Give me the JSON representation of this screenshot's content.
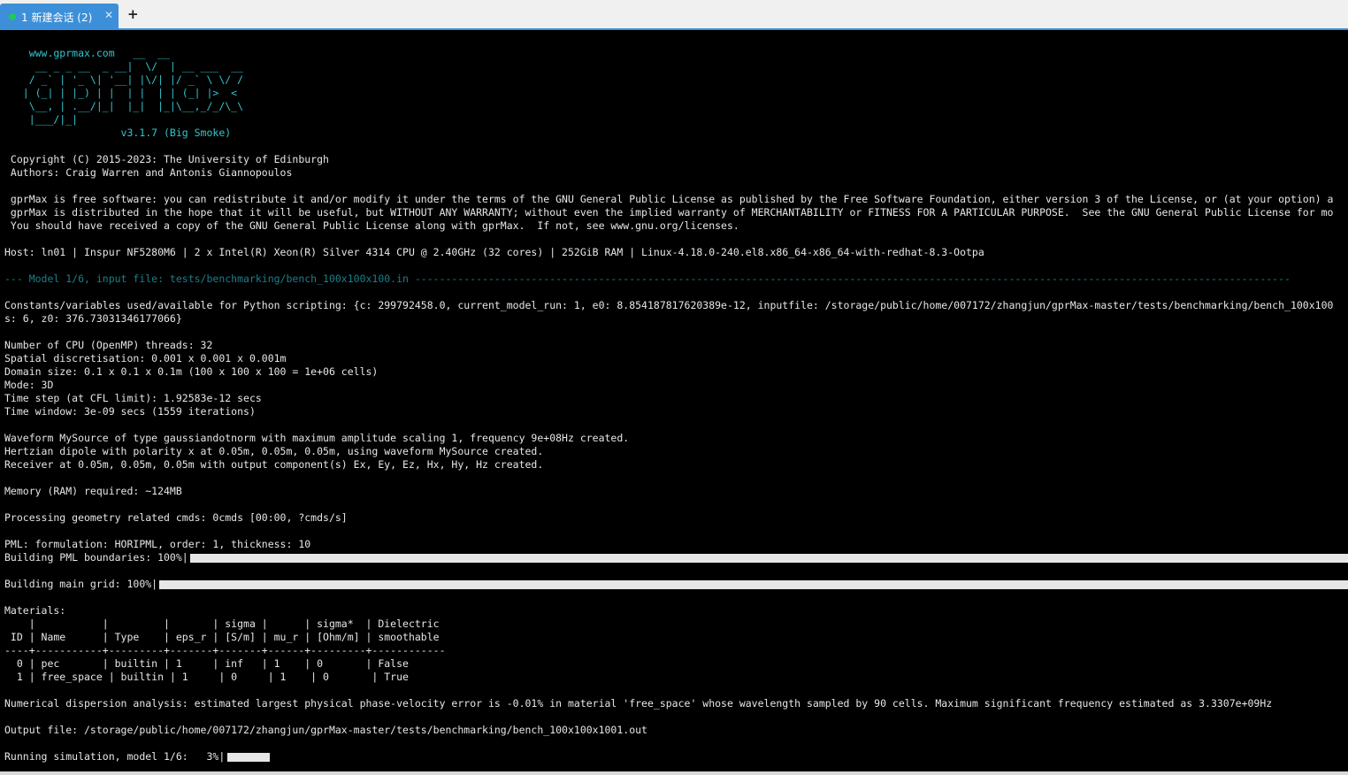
{
  "tab": {
    "label": "1 新建会话 (2)",
    "close_glyph": "✕",
    "status_color": "#22c55e"
  },
  "new_tab_glyph": "+",
  "terminal": {
    "logo": [
      "    www.gprmax.com   __  __",
      "     __ _ _ __  _ __|  \\/  | __ ___  __",
      "    / _` | '_ \\| '__| |\\/| |/ _` \\ \\/ /",
      "   | (_| | |_) | |  | |  | | (_| |>  <",
      "    \\__, | .__/|_|  |_|  |_|\\__,_/_/\\_\\",
      "    |___/|_|"
    ],
    "version": "                   v3.1.7 (Big Smoke)",
    "copyright": " Copyright (C) 2015-2023: The University of Edinburgh",
    "authors": " Authors: Craig Warren and Antonis Giannopoulos",
    "license_1": " gprMax is free software: you can redistribute it and/or modify it under the terms of the GNU General Public License as published by the Free Software Foundation, either version 3 of the License, or (at your option) a",
    "license_2": " gprMax is distributed in the hope that it will be useful, but WITHOUT ANY WARRANTY; without even the implied warranty of MERCHANTABILITY or FITNESS FOR A PARTICULAR PURPOSE.  See the GNU General Public License for mo",
    "license_3": " You should have received a copy of the GNU General Public License along with gprMax.  If not, see www.gnu.org/licenses.",
    "host": "Host: ln01 | Inspur NF5280M6 | 2 x Intel(R) Xeon(R) Silver 4314 CPU @ 2.40GHz (32 cores) | 252GiB RAM | Linux-4.18.0-240.el8.x86_64-x86_64-with-redhat-8.3-Ootpa",
    "model_header": "--- Model 1/6, input file: tests/benchmarking/bench_100x100x100.in -----------------------------------------------------------------------------------------------------------------------------------------------",
    "constants_1": "Constants/variables used/available for Python scripting: {c: 299792458.0, current_model_run: 1, e0: 8.854187817620389e-12, inputfile: /storage/public/home/007172/zhangjun/gprMax-master/tests/benchmarking/bench_100x100",
    "constants_2": "s: 6, z0: 376.73031346177066}",
    "cpu_threads": "Number of CPU (OpenMP) threads: 32",
    "spatial": "Spatial discretisation: 0.001 x 0.001 x 0.001m",
    "domain": "Domain size: 0.1 x 0.1 x 0.1m (100 x 100 x 100 = 1e+06 cells)",
    "mode": "Mode: 3D",
    "time_step": "Time step (at CFL limit): 1.92583e-12 secs",
    "time_window": "Time window: 3e-09 secs (1559 iterations)",
    "waveform": "Waveform MySource of type gaussiandotnorm with maximum amplitude scaling 1, frequency 9e+08Hz created.",
    "hertzian": "Hertzian dipole with polarity x at 0.05m, 0.05m, 0.05m, using waveform MySource created.",
    "receiver": "Receiver at 0.05m, 0.05m, 0.05m with output component(s) Ex, Ey, Ez, Hx, Hy, Hz created.",
    "memory": "Memory (RAM) required: ~124MB",
    "geometry": "Processing geometry related cmds: 0cmds [00:00, ?cmds/s]",
    "pml": "PML: formulation: HORIPML, order: 1, thickness: 10",
    "pml_progress_label": "Building PML boundaries: 100%|",
    "pml_progress": 1.0,
    "grid_progress_label": "Building main grid: 100%|",
    "grid_progress": 1.0,
    "materials_label": "Materials:",
    "materials_table": [
      "    |           |         |       | sigma |      | sigma*  | Dielectric",
      " ID | Name      | Type    | eps_r | [S/m] | mu_r | [Ohm/m] | smoothable",
      "----+-----------+---------+-------+-------+------+---------+------------",
      "  0 | pec       | builtin | 1     | inf   | 1    | 0       | False",
      "  1 | free_space | builtin | 1     | 0     | 1    | 0       | True"
    ],
    "dispersion": "Numerical dispersion analysis: estimated largest physical phase-velocity error is -0.01% in material 'free_space' whose wavelength sampled by 90 cells. Maximum significant frequency estimated as 3.3307e+09Hz",
    "output_file": "Output file: /storage/public/home/007172/zhangjun/gprMax-master/tests/benchmarking/bench_100x100x1001.out",
    "running_label": "Running simulation, model 1/6:   3%|",
    "running_progress": 0.03
  }
}
